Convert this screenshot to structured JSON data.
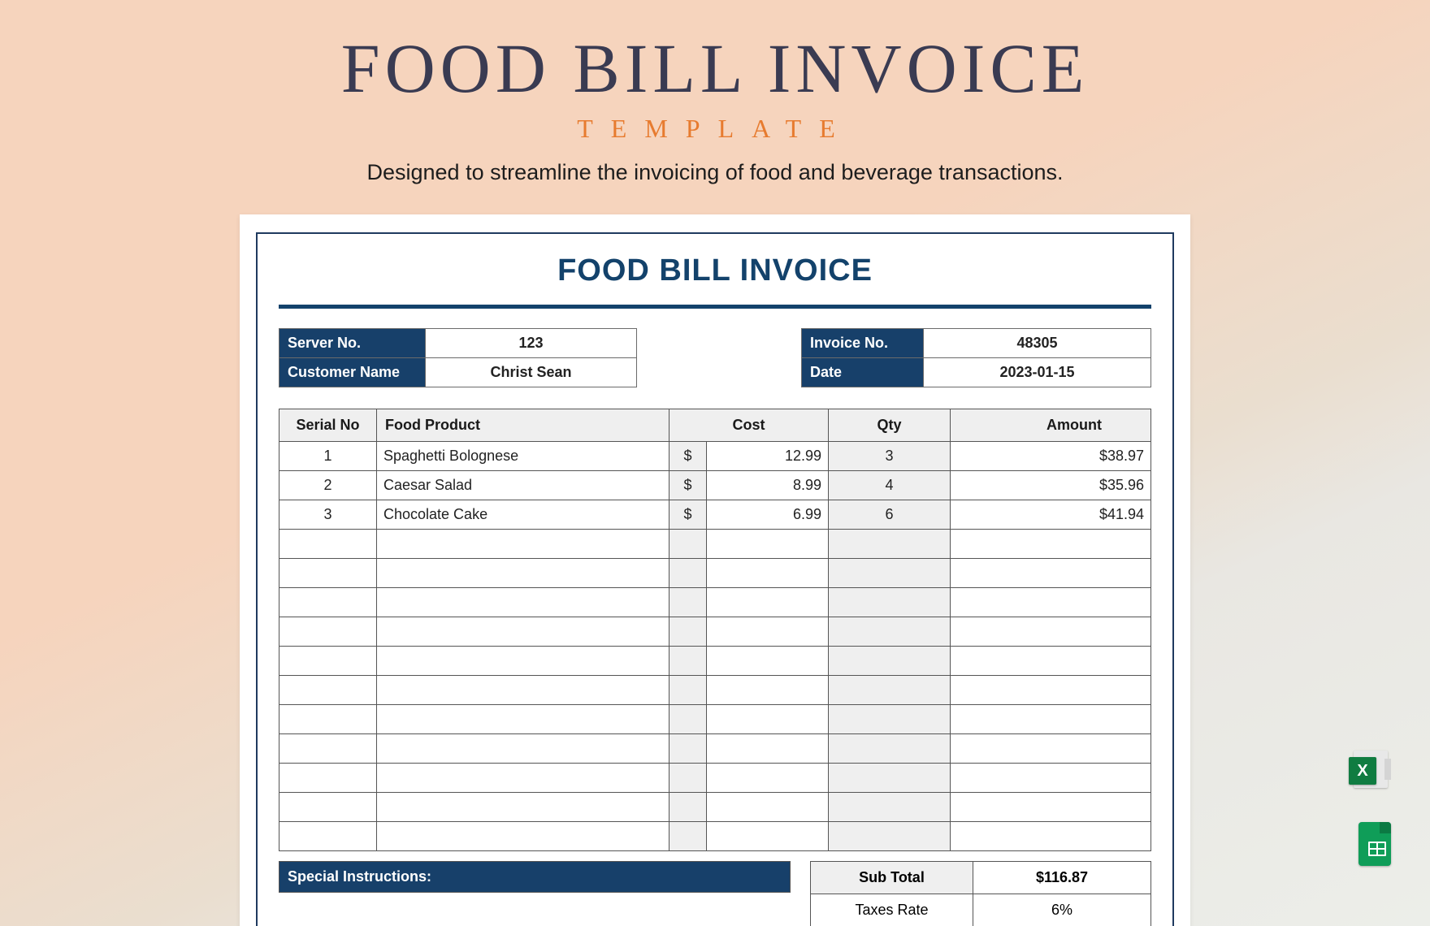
{
  "hero": {
    "title": "FOOD BILL INVOICE",
    "subtitle": "TEMPLATE",
    "description": "Designed to streamline the invoicing of food and beverage transactions."
  },
  "doc": {
    "title": "FOOD BILL INVOICE",
    "meta_left": {
      "server_no_label": "Server No.",
      "server_no_value": "123",
      "customer_name_label": "Customer Name",
      "customer_name_value": "Christ Sean"
    },
    "meta_right": {
      "invoice_no_label": "Invoice No.",
      "invoice_no_value": "48305",
      "date_label": "Date",
      "date_value": "2023-01-15"
    },
    "columns": {
      "serial": "Serial No",
      "product": "Food Product",
      "cost": "Cost",
      "qty": "Qty",
      "amount": "Amount"
    },
    "currency": "$",
    "rows": [
      {
        "serial": "1",
        "product": "Spaghetti Bolognese",
        "cost": "12.99",
        "qty": "3",
        "amount": "$38.97"
      },
      {
        "serial": "2",
        "product": "Caesar Salad",
        "cost": "8.99",
        "qty": "4",
        "amount": "$35.96"
      },
      {
        "serial": "3",
        "product": "Chocolate Cake",
        "cost": "6.99",
        "qty": "6",
        "amount": "$41.94"
      }
    ],
    "empty_row_count": 11,
    "special_instructions_label": "Special Instructions:",
    "totals": {
      "subtotal_label": "Sub Total",
      "subtotal_value": "$116.87",
      "tax_rate_label": "Taxes Rate",
      "tax_rate_value": "6%"
    }
  },
  "icons": {
    "excel": "X",
    "sheets": "sheets"
  }
}
